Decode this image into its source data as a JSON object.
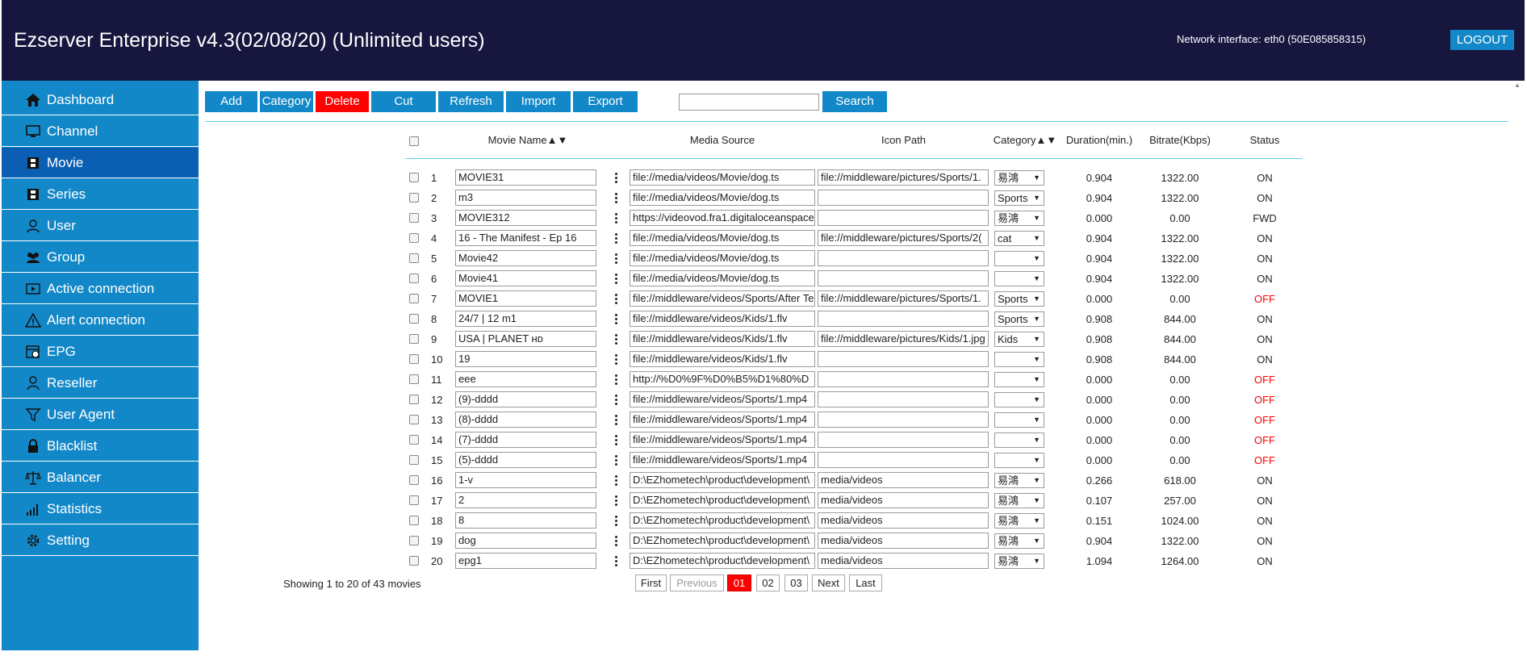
{
  "header": {
    "title": "Ezserver Enterprise v4.3(02/08/20) (Unlimited users)",
    "network": "Network interface: eth0 (50E085858315)",
    "logout": "LOGOUT"
  },
  "sidebar": {
    "items": [
      {
        "label": "Dashboard",
        "icon": "home-icon"
      },
      {
        "label": "Channel",
        "icon": "monitor-icon"
      },
      {
        "label": "Movie",
        "icon": "film-icon",
        "active": true
      },
      {
        "label": "Series",
        "icon": "film-icon"
      },
      {
        "label": "User",
        "icon": "user-icon"
      },
      {
        "label": "Group",
        "icon": "group-icon"
      },
      {
        "label": "Active connection",
        "icon": "play-box-icon"
      },
      {
        "label": "Alert connection",
        "icon": "warning-icon"
      },
      {
        "label": "EPG",
        "icon": "calendar-clock-icon"
      },
      {
        "label": "Reseller",
        "icon": "reseller-icon"
      },
      {
        "label": "User Agent",
        "icon": "funnel-icon"
      },
      {
        "label": "Blacklist",
        "icon": "lock-icon"
      },
      {
        "label": "Balancer",
        "icon": "scale-icon"
      },
      {
        "label": "Statistics",
        "icon": "bar-chart-icon"
      },
      {
        "label": "Setting",
        "icon": "gear-icon"
      }
    ]
  },
  "toolbar": {
    "add": "Add",
    "category": "Category",
    "delete": "Delete",
    "cut": "Cut",
    "refresh": "Refresh",
    "import": "Import",
    "export": "Export",
    "search_value": "",
    "search": "Search"
  },
  "table": {
    "headers": {
      "name": "Movie Name▲▼",
      "source": "Media Source",
      "icon": "Icon Path",
      "category": "Category▲▼",
      "duration": "Duration(min.)",
      "bitrate": "Bitrate(Kbps)",
      "status": "Status"
    },
    "rows": [
      {
        "num": "1",
        "name": "MOVIE31",
        "source": "file://media/videos/Movie/dog.ts",
        "icon": "file://middleware/pictures/Sports/1.",
        "category": "易鴻",
        "duration": "0.904",
        "bitrate": "1322.00",
        "status": "ON"
      },
      {
        "num": "2",
        "name": "m3",
        "source": "file://media/videos/Movie/dog.ts",
        "icon": "",
        "category": "Sports",
        "duration": "0.904",
        "bitrate": "1322.00",
        "status": "ON"
      },
      {
        "num": "3",
        "name": "MOVIE312",
        "source": "https://videovod.fra1.digitaloceanspace",
        "icon": "",
        "category": "易鴻",
        "duration": "0.000",
        "bitrate": "0.00",
        "status": "FWD"
      },
      {
        "num": "4",
        "name": "16 - The Manifest - Ep 16",
        "source": "file://media/videos/Movie/dog.ts",
        "icon": "file://middleware/pictures/Sports/2(",
        "category": "cat",
        "duration": "0.904",
        "bitrate": "1322.00",
        "status": "ON"
      },
      {
        "num": "5",
        "name": "Movie42",
        "source": "file://media/videos/Movie/dog.ts",
        "icon": "",
        "category": "",
        "duration": "0.904",
        "bitrate": "1322.00",
        "status": "ON"
      },
      {
        "num": "6",
        "name": "Movie41",
        "source": "file://media/videos/Movie/dog.ts",
        "icon": "",
        "category": "",
        "duration": "0.904",
        "bitrate": "1322.00",
        "status": "ON"
      },
      {
        "num": "7",
        "name": "MOVIE1",
        "source": "file://middleware/videos/Sports/After Te",
        "icon": "file://middleware/pictures/Sports/1.",
        "category": "Sports",
        "duration": "0.000",
        "bitrate": "0.00",
        "status": "OFF"
      },
      {
        "num": "8",
        "name": "24/7 | 12 m1",
        "source": "file://middleware/videos/Kids/1.flv",
        "icon": "",
        "category": "Sports",
        "duration": "0.908",
        "bitrate": "844.00",
        "status": "ON"
      },
      {
        "num": "9",
        "name": "USA | PLANET ʜᴅ",
        "source": "file://middleware/videos/Kids/1.flv",
        "icon": "file://middleware/pictures/Kids/1.jpg",
        "category": "Kids",
        "duration": "0.908",
        "bitrate": "844.00",
        "status": "ON"
      },
      {
        "num": "10",
        "name": "19",
        "source": "file://middleware/videos/Kids/1.flv",
        "icon": "",
        "category": "",
        "duration": "0.908",
        "bitrate": "844.00",
        "status": "ON"
      },
      {
        "num": "11",
        "name": "eee",
        "source": "http://%D0%9F%D0%B5%D1%80%D",
        "icon": "",
        "category": "",
        "duration": "0.000",
        "bitrate": "0.00",
        "status": "OFF"
      },
      {
        "num": "12",
        "name": "(9)-dddd",
        "source": "file://middleware/videos/Sports/1.mp4",
        "icon": "",
        "category": "",
        "duration": "0.000",
        "bitrate": "0.00",
        "status": "OFF"
      },
      {
        "num": "13",
        "name": "(8)-dddd",
        "source": "file://middleware/videos/Sports/1.mp4",
        "icon": "",
        "category": "",
        "duration": "0.000",
        "bitrate": "0.00",
        "status": "OFF"
      },
      {
        "num": "14",
        "name": "(7)-dddd",
        "source": "file://middleware/videos/Sports/1.mp4",
        "icon": "",
        "category": "",
        "duration": "0.000",
        "bitrate": "0.00",
        "status": "OFF"
      },
      {
        "num": "15",
        "name": "(5)-dddd",
        "source": "file://middleware/videos/Sports/1.mp4",
        "icon": "",
        "category": "",
        "duration": "0.000",
        "bitrate": "0.00",
        "status": "OFF"
      },
      {
        "num": "16",
        "name": "1-v",
        "source": "D:\\EZhometech\\product\\development\\",
        "icon": "media/videos",
        "category": "易鴻",
        "duration": "0.266",
        "bitrate": "618.00",
        "status": "ON"
      },
      {
        "num": "17",
        "name": "2",
        "source": "D:\\EZhometech\\product\\development\\",
        "icon": "media/videos",
        "category": "易鴻",
        "duration": "0.107",
        "bitrate": "257.00",
        "status": "ON"
      },
      {
        "num": "18",
        "name": "8",
        "source": "D:\\EZhometech\\product\\development\\",
        "icon": "media/videos",
        "category": "易鴻",
        "duration": "0.151",
        "bitrate": "1024.00",
        "status": "ON"
      },
      {
        "num": "19",
        "name": "dog",
        "source": "D:\\EZhometech\\product\\development\\",
        "icon": "media/videos",
        "category": "易鴻",
        "duration": "0.904",
        "bitrate": "1322.00",
        "status": "ON"
      },
      {
        "num": "20",
        "name": "epg1",
        "source": "D:\\EZhometech\\product\\development\\",
        "icon": "media/videos",
        "category": "易鴻",
        "duration": "1.094",
        "bitrate": "1264.00",
        "status": "ON"
      }
    ]
  },
  "footer": {
    "showing": "Showing 1 to 20 of 43 movies",
    "pager": {
      "first": "First",
      "previous": "Previous",
      "pages": [
        "01",
        "02",
        "03"
      ],
      "current": "01",
      "next": "Next",
      "last": "Last"
    }
  },
  "colors": {
    "header_bg": "#17163f",
    "sidebar_bg": "#1388c8",
    "sidebar_active": "#0b5fb3",
    "accent": "#1388c8",
    "delete": "#ff0000",
    "off": "#ff0000",
    "divider": "#5bd6e8"
  }
}
